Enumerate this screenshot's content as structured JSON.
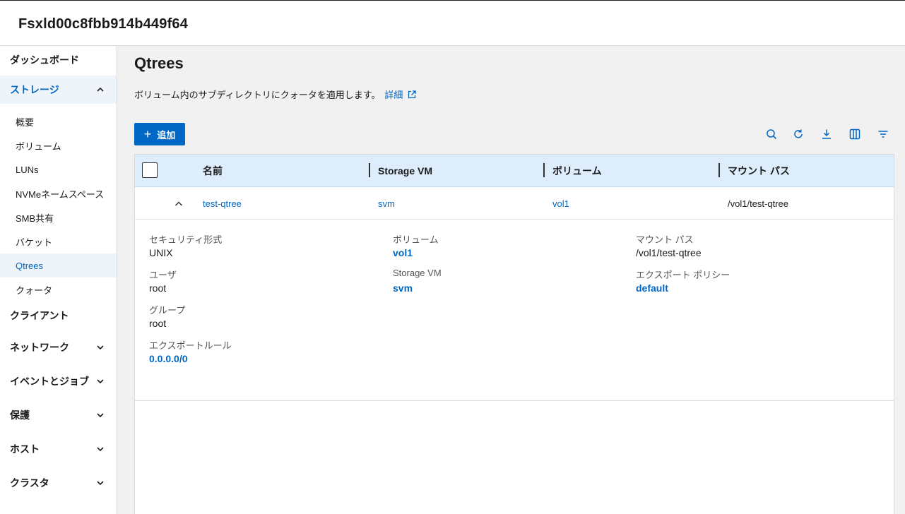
{
  "app": {
    "title": "Fsxld00c8fbb914b449f64"
  },
  "sidebar": {
    "dashboard": "ダッシュボード",
    "storage": "ストレージ",
    "storage_items": [
      "概要",
      "ボリューム",
      "LUNs",
      "NVMeネームスペース",
      "SMB共有",
      "バケット",
      "Qtrees",
      "クォータ"
    ],
    "clients": "クライアント",
    "network": "ネットワーク",
    "events": "イベントとジョブ",
    "protection": "保護",
    "hosts": "ホスト",
    "cluster": "クラスタ",
    "active_item": "Qtrees"
  },
  "page": {
    "title": "Qtrees",
    "description": "ボリューム内のサブディレクトリにクォータを適用します。",
    "details_link": "詳細",
    "add_label": "追加"
  },
  "toolbar_icons": [
    "search-icon",
    "refresh-icon",
    "download-icon",
    "columns-icon",
    "filter-icon"
  ],
  "table": {
    "columns": [
      "名前",
      "Storage VM",
      "ボリューム",
      "マウント パス"
    ],
    "rows": [
      {
        "name": "test-qtree",
        "svm": "svm",
        "volume": "vol1",
        "mount_path": "/vol1/test-qtree"
      }
    ]
  },
  "details": {
    "security_label": "セキュリティ形式",
    "security_value": "UNIX",
    "user_label": "ユーザ",
    "user_value": "root",
    "group_label": "グループ",
    "group_value": "root",
    "export_rule_label": "エクスポートルール",
    "export_rule_value": "0.0.0.0/0",
    "volume_label": "ボリューム",
    "volume_value": "vol1",
    "svm_label": "Storage VM",
    "svm_value": "svm",
    "mount_label": "マウント パス",
    "mount_value": "/vol1/test-qtree",
    "export_policy_label": "エクスポート ポリシー",
    "export_policy_value": "default"
  },
  "colors": {
    "accent": "#0067c5",
    "header_bg": "#ddedfb",
    "active_bg": "#eef4fa"
  }
}
